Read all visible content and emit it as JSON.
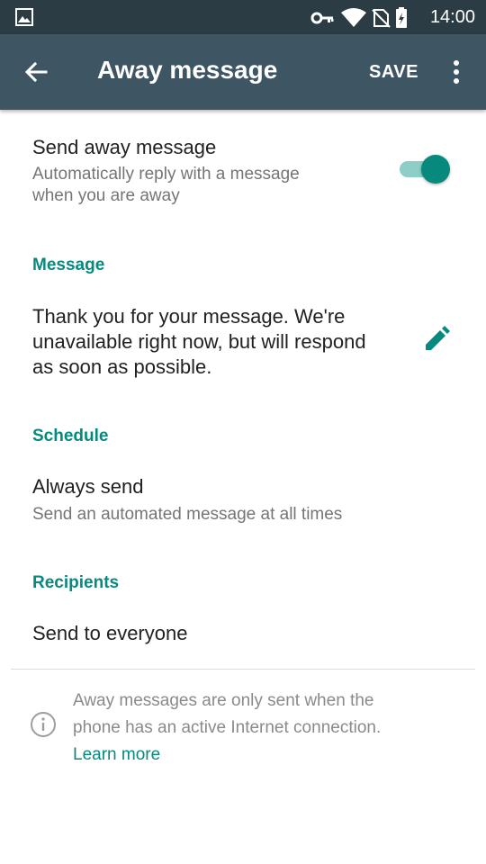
{
  "status_bar": {
    "time": "14:00",
    "icons": [
      "gallery-icon",
      "key-icon",
      "wifi-icon",
      "no-sim-icon",
      "battery-charging-icon"
    ]
  },
  "app_bar": {
    "title": "Away message",
    "save_label": "SAVE",
    "icons": [
      "back-arrow-icon",
      "more-vert-icon"
    ]
  },
  "send_away": {
    "title": "Send away message",
    "subtitle_line1": "Automatically reply with a message",
    "subtitle_line2": "when you are away",
    "enabled": true
  },
  "message_section": {
    "header": "Message",
    "line1": "Thank you for your message. We're",
    "line2": "unavailable right now, but will respond",
    "line3": "as soon as possible.",
    "icon": "edit-pencil-icon"
  },
  "schedule_section": {
    "header": "Schedule",
    "title": "Always send",
    "subtitle": "Send an automated message at all times"
  },
  "recipients_section": {
    "header": "Recipients",
    "title": "Send to everyone"
  },
  "footer_note": {
    "line1": "Away messages are only sent when the",
    "line2": "phone has an active Internet connection.",
    "link": "Learn more",
    "icon": "info-icon"
  },
  "colors": {
    "status_bar": "#2b3c45",
    "app_bar": "#3e5664",
    "accent": "#078a7d",
    "toggle_track": "#8dcfc6"
  }
}
